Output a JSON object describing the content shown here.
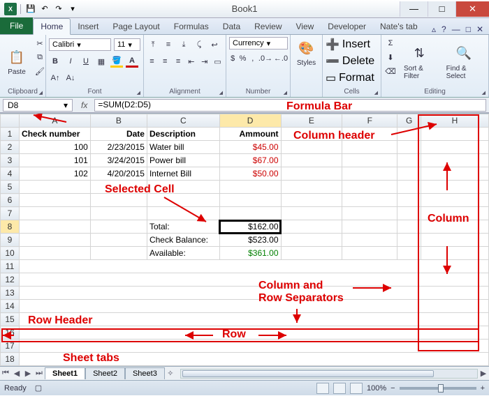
{
  "window": {
    "title": "Book1"
  },
  "qat": {
    "save": "💾",
    "undo": "↶",
    "redo": "↷",
    "more": "▾"
  },
  "win": {
    "min": "—",
    "max": "□",
    "close": "✕"
  },
  "tabs": {
    "file": "File",
    "home": "Home",
    "insert": "Insert",
    "page": "Page Layout",
    "formulas": "Formulas",
    "data": "Data",
    "review": "Review",
    "view": "View",
    "developer": "Developer",
    "nate": "Nate's tab"
  },
  "ribbon": {
    "clipboard": {
      "paste": "Paste",
      "label": "Clipboard"
    },
    "font": {
      "name": "Calibri",
      "size": "11",
      "label": "Font"
    },
    "alignment": {
      "label": "Alignment",
      "wrap": "Wrap Text",
      "merge": "Merge"
    },
    "number": {
      "format": "Currency",
      "label": "Number"
    },
    "styles": {
      "label": "Styles",
      "btn": "Styles"
    },
    "cells": {
      "insert": "Insert",
      "delete": "Delete",
      "format": "Format",
      "label": "Cells"
    },
    "editing": {
      "sort": "Sort & Filter",
      "find": "Find & Select",
      "label": "Editing"
    }
  },
  "fbar": {
    "name": "D8",
    "fx": "fx",
    "formula": "=SUM(D2:D5)"
  },
  "columns": [
    "A",
    "B",
    "C",
    "D",
    "E",
    "F",
    "G",
    "H"
  ],
  "rows": [
    "1",
    "2",
    "3",
    "4",
    "5",
    "6",
    "7",
    "8",
    "9",
    "10",
    "11",
    "12",
    "13",
    "14",
    "15",
    "16",
    "17",
    "18"
  ],
  "headers": {
    "a": "Check number",
    "b": "Date",
    "c": "Description",
    "d": "Ammount"
  },
  "data": {
    "r2": {
      "a": "100",
      "b": "2/23/2015",
      "c": "Water bill",
      "d": "$45.00"
    },
    "r3": {
      "a": "101",
      "b": "3/24/2015",
      "c": "Power bill",
      "d": "$67.00"
    },
    "r4": {
      "a": "102",
      "b": "4/20/2015",
      "c": "Internet Bill",
      "d": "$50.00"
    },
    "r8": {
      "c": "Total:",
      "d": "$162.00"
    },
    "r9": {
      "c": "Check Balance:",
      "d": "$523.00"
    },
    "r10": {
      "c": "Available:",
      "d": "$361.00"
    }
  },
  "sheets": {
    "s1": "Sheet1",
    "s2": "Sheet2",
    "s3": "Sheet3"
  },
  "status": {
    "ready": "Ready",
    "zoom": "100%",
    "minus": "−",
    "plus": "+"
  },
  "anno": {
    "formula_bar": "Formula Bar",
    "column_header": "Column header",
    "selected_cell": "Selected Cell",
    "column": "Column",
    "col_row_sep": "Column and\nRow Separators",
    "row_header": "Row Header",
    "row": "Row",
    "sheet_tabs": "Sheet tabs"
  }
}
